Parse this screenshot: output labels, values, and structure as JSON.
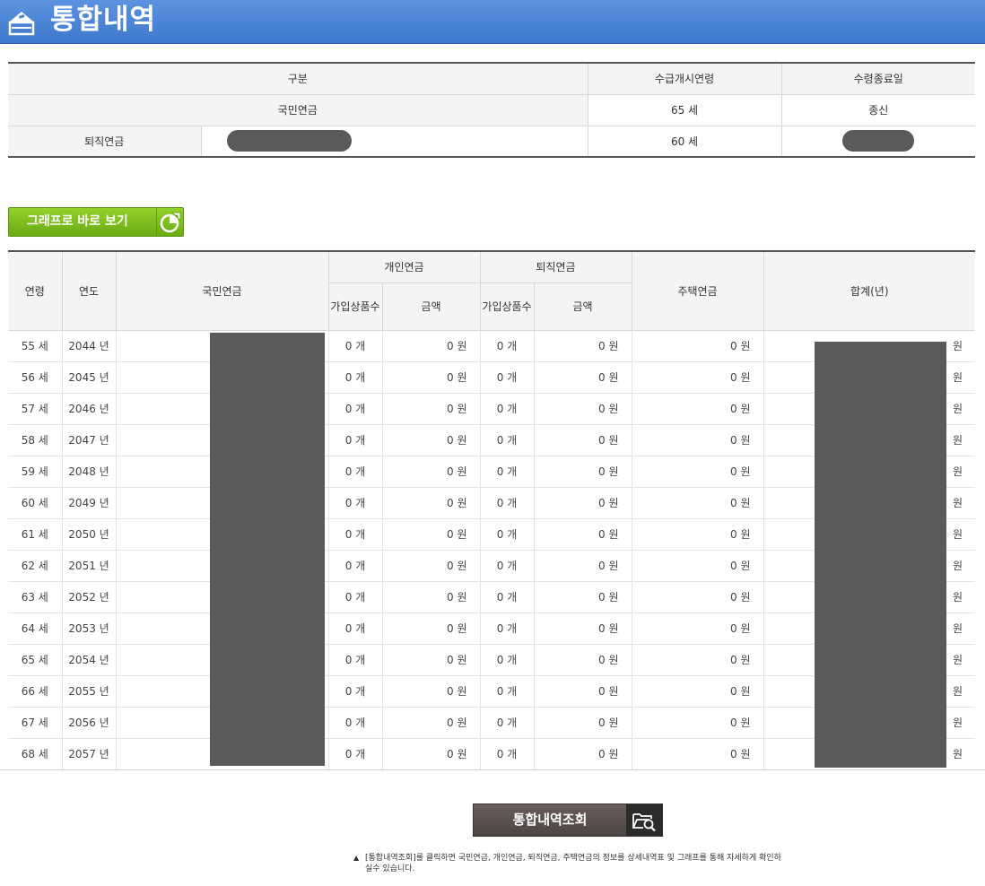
{
  "header": {
    "title": "통합내역"
  },
  "summary": {
    "headers": {
      "category": "구분",
      "start_age": "수급개시연령",
      "end_date": "수령종료일"
    },
    "national": {
      "label": "국민연금",
      "start_age": "65 세",
      "end_date": "종신"
    },
    "retirement": {
      "label": "퇴직연금",
      "start_age": "60 세"
    }
  },
  "graph_button": {
    "label": "그래프로 바로 보기"
  },
  "table": {
    "headers": {
      "age": "연령",
      "year": "연도",
      "national": "국민연금",
      "personal": "개인연금",
      "retirement": "퇴직연금",
      "housing": "주택연금",
      "total": "합계(년)",
      "products": "가입상품수",
      "amount": "금액"
    },
    "rows": [
      {
        "age": "55 세",
        "year": "2044 년",
        "p_count": "0 개",
        "p_amount": "0 원",
        "r_count": "0 개",
        "r_amount": "0 원",
        "housing": "0 원",
        "total_unit": "원"
      },
      {
        "age": "56 세",
        "year": "2045 년",
        "p_count": "0 개",
        "p_amount": "0 원",
        "r_count": "0 개",
        "r_amount": "0 원",
        "housing": "0 원",
        "total_unit": "원"
      },
      {
        "age": "57 세",
        "year": "2046 년",
        "p_count": "0 개",
        "p_amount": "0 원",
        "r_count": "0 개",
        "r_amount": "0 원",
        "housing": "0 원",
        "total_unit": "원"
      },
      {
        "age": "58 세",
        "year": "2047 년",
        "p_count": "0 개",
        "p_amount": "0 원",
        "r_count": "0 개",
        "r_amount": "0 원",
        "housing": "0 원",
        "total_unit": "원"
      },
      {
        "age": "59 세",
        "year": "2048 년",
        "p_count": "0 개",
        "p_amount": "0 원",
        "r_count": "0 개",
        "r_amount": "0 원",
        "housing": "0 원",
        "total_unit": "원"
      },
      {
        "age": "60 세",
        "year": "2049 년",
        "p_count": "0 개",
        "p_amount": "0 원",
        "r_count": "0 개",
        "r_amount": "0 원",
        "housing": "0 원",
        "total_unit": "원"
      },
      {
        "age": "61 세",
        "year": "2050 년",
        "p_count": "0 개",
        "p_amount": "0 원",
        "r_count": "0 개",
        "r_amount": "0 원",
        "housing": "0 원",
        "total_unit": "원"
      },
      {
        "age": "62 세",
        "year": "2051 년",
        "p_count": "0 개",
        "p_amount": "0 원",
        "r_count": "0 개",
        "r_amount": "0 원",
        "housing": "0 원",
        "total_unit": "원"
      },
      {
        "age": "63 세",
        "year": "2052 년",
        "p_count": "0 개",
        "p_amount": "0 원",
        "r_count": "0 개",
        "r_amount": "0 원",
        "housing": "0 원",
        "total_unit": "원"
      },
      {
        "age": "64 세",
        "year": "2053 년",
        "p_count": "0 개",
        "p_amount": "0 원",
        "r_count": "0 개",
        "r_amount": "0 원",
        "housing": "0 원",
        "total_unit": "원"
      },
      {
        "age": "65 세",
        "year": "2054 년",
        "p_count": "0 개",
        "p_amount": "0 원",
        "r_count": "0 개",
        "r_amount": "0 원",
        "housing": "0 원",
        "total_unit": "원"
      },
      {
        "age": "66 세",
        "year": "2055 년",
        "p_count": "0 개",
        "p_amount": "0 원",
        "r_count": "0 개",
        "r_amount": "0 원",
        "housing": "0 원",
        "total_unit": "원"
      },
      {
        "age": "67 세",
        "year": "2056 년",
        "p_count": "0 개",
        "p_amount": "0 원",
        "r_count": "0 개",
        "r_amount": "0 원",
        "housing": "0 원",
        "total_unit": "원"
      },
      {
        "age": "68 세",
        "year": "2057 년",
        "p_count": "0 개",
        "p_amount": "0 원",
        "r_count": "0 개",
        "r_amount": "0 원",
        "housing": "0 원",
        "total_unit": "원"
      }
    ]
  },
  "inquiry_button": {
    "label": "통합내역조회"
  },
  "note": {
    "text": "[통합내역조회]를 클릭하면 국민연금, 개인연금, 퇴직연금, 주택연금의 정보를 상세내역표 및 그래프를 통해 자세하게 확인하실수 있습니다."
  },
  "colors": {
    "header": "#4a84d6",
    "graph_button": "#7bbd1c",
    "inquiry_button": "#5a4f4f",
    "redaction": "#5a5a5a"
  }
}
